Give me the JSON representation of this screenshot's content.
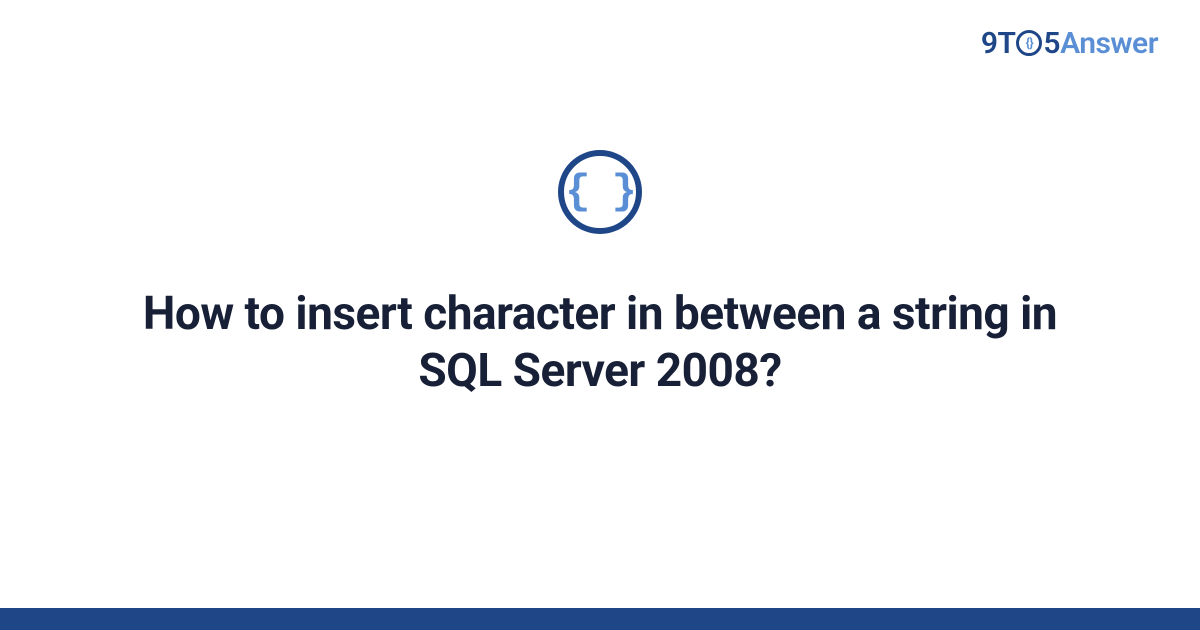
{
  "brand": {
    "part1": "9T",
    "circle_inner": "{}",
    "part2": "5",
    "part3": "Answer"
  },
  "icon": {
    "glyph": "{ }"
  },
  "question": {
    "title": "How to insert character in between a string in SQL Server 2008?"
  }
}
